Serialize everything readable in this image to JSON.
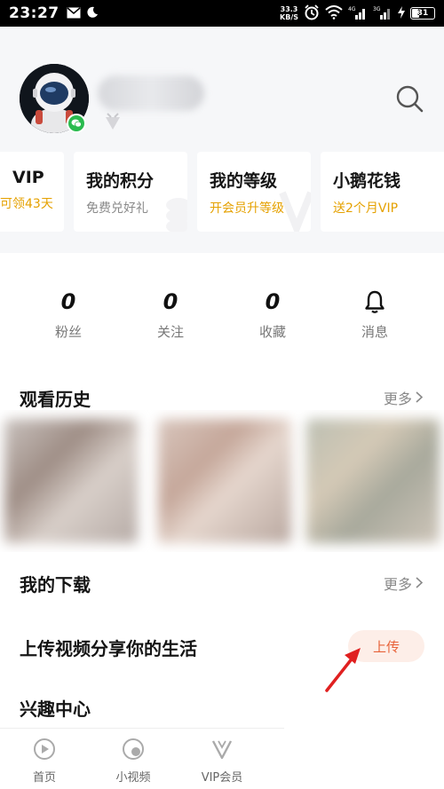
{
  "status_bar": {
    "time": "23:27",
    "speed_value": "33.3",
    "speed_unit": "KB/S",
    "battery": "31",
    "icons": [
      "mail-icon",
      "moon-icon",
      "alarm-icon",
      "wifi-icon",
      "signal-4g-icon",
      "signal-3g-icon",
      "charging-icon"
    ]
  },
  "profile": {
    "avatar_icon": "astronaut-avatar",
    "badge_icon": "wechat-icon",
    "search_icon": "search-icon"
  },
  "cards": [
    {
      "title": "VIP",
      "subtitle": "可领43天",
      "subtitle_color": "gold"
    },
    {
      "title": "我的积分",
      "subtitle": "免费兑好礼",
      "subtitle_color": "gray"
    },
    {
      "title": "我的等级",
      "subtitle": "开会员升等级",
      "subtitle_color": "gold"
    },
    {
      "title": "小鹅花钱",
      "subtitle": "送2个月VIP",
      "subtitle_color": "gold"
    }
  ],
  "stats": [
    {
      "value": "0",
      "label": "粉丝"
    },
    {
      "value": "0",
      "label": "关注"
    },
    {
      "value": "0",
      "label": "收藏"
    },
    {
      "icon": "bell-icon",
      "label": "消息"
    }
  ],
  "history": {
    "title": "观看历史",
    "more": "更多"
  },
  "downloads": {
    "title": "我的下载",
    "more": "更多"
  },
  "upload": {
    "title": "上传视频分享你的生活",
    "button": "上传"
  },
  "interest": {
    "title": "兴趣中心"
  },
  "bottom_nav": [
    {
      "label": "首页",
      "icon": "home-play-icon"
    },
    {
      "label": "小视频",
      "icon": "short-video-icon"
    },
    {
      "label": "VIP会员",
      "icon": "vip-icon"
    }
  ],
  "colors": {
    "gold": "#e5a100",
    "upload_text": "#e8633a",
    "upload_bg": "#fdeee8",
    "arrow": "#e02020"
  }
}
